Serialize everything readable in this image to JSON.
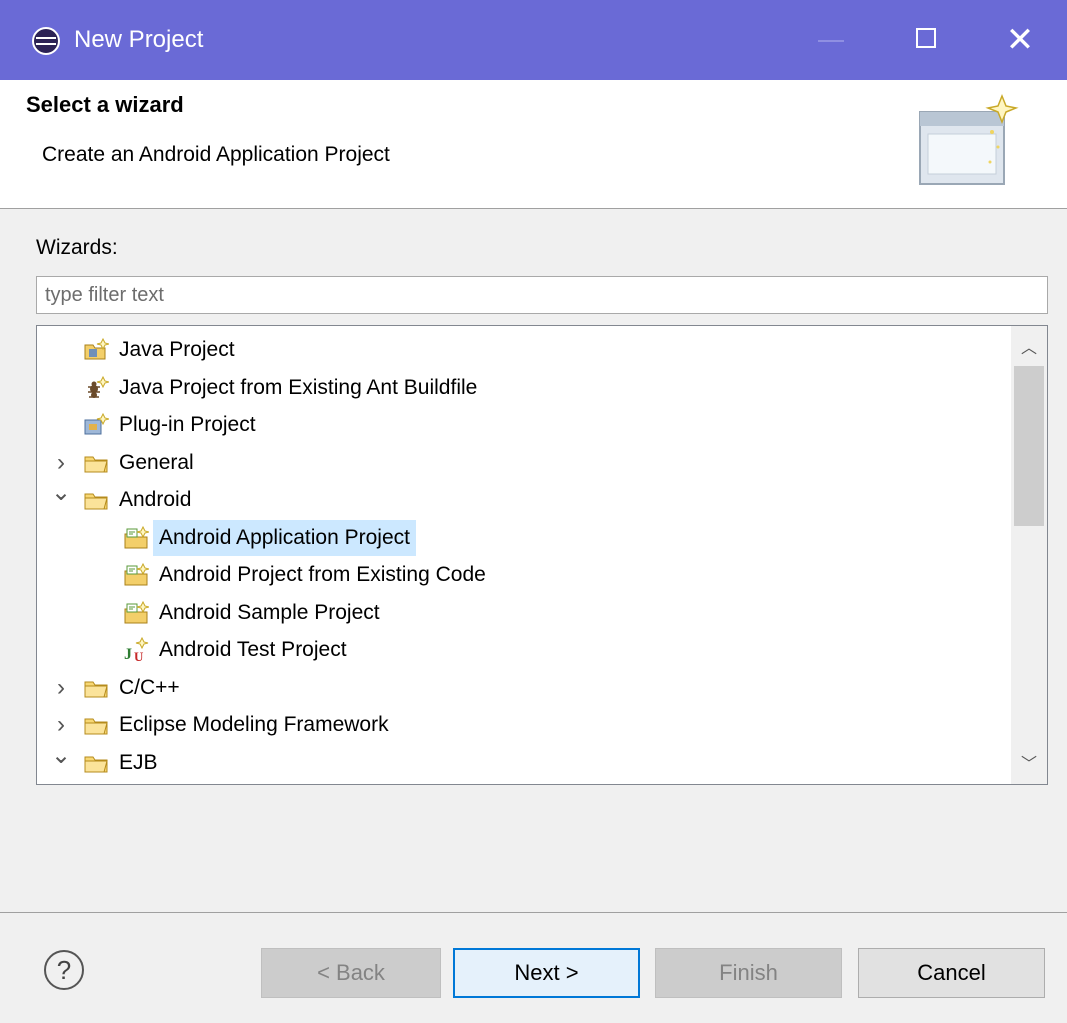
{
  "window": {
    "title": "New Project"
  },
  "header": {
    "title": "Select a wizard",
    "description": "Create an Android Application Project"
  },
  "wizards_label": "Wizards:",
  "filter": {
    "placeholder": "type filter text",
    "value": ""
  },
  "tree": {
    "items": [
      {
        "label": "Java Project",
        "icon": "java-project-icon",
        "expander": "none"
      },
      {
        "label": "Java Project from Existing Ant Buildfile",
        "icon": "ant-buildfile-icon",
        "expander": "none"
      },
      {
        "label": "Plug-in Project",
        "icon": "plugin-project-icon",
        "expander": "none"
      },
      {
        "label": "General",
        "icon": "folder-icon",
        "expander": "collapsed"
      },
      {
        "label": "Android",
        "icon": "folder-icon",
        "expander": "expanded"
      },
      {
        "label": "Android Application Project",
        "icon": "android-project-icon",
        "expander": "none",
        "selected": true
      },
      {
        "label": "Android Project from Existing Code",
        "icon": "android-project-icon",
        "expander": "none"
      },
      {
        "label": "Android Sample Project",
        "icon": "android-project-icon",
        "expander": "none"
      },
      {
        "label": "Android Test Project",
        "icon": "junit-project-icon",
        "expander": "none"
      },
      {
        "label": "C/C++",
        "icon": "folder-icon",
        "expander": "collapsed"
      },
      {
        "label": "Eclipse Modeling Framework",
        "icon": "folder-icon",
        "expander": "collapsed"
      },
      {
        "label": "EJB",
        "icon": "folder-icon",
        "expander": "expanded"
      }
    ]
  },
  "buttons": {
    "back": "< Back",
    "next": "Next >",
    "finish": "Finish",
    "cancel": "Cancel"
  },
  "colors": {
    "titlebar": "#6a6ad6",
    "selection": "#cce8ff",
    "default_button_border": "#0078d7"
  }
}
